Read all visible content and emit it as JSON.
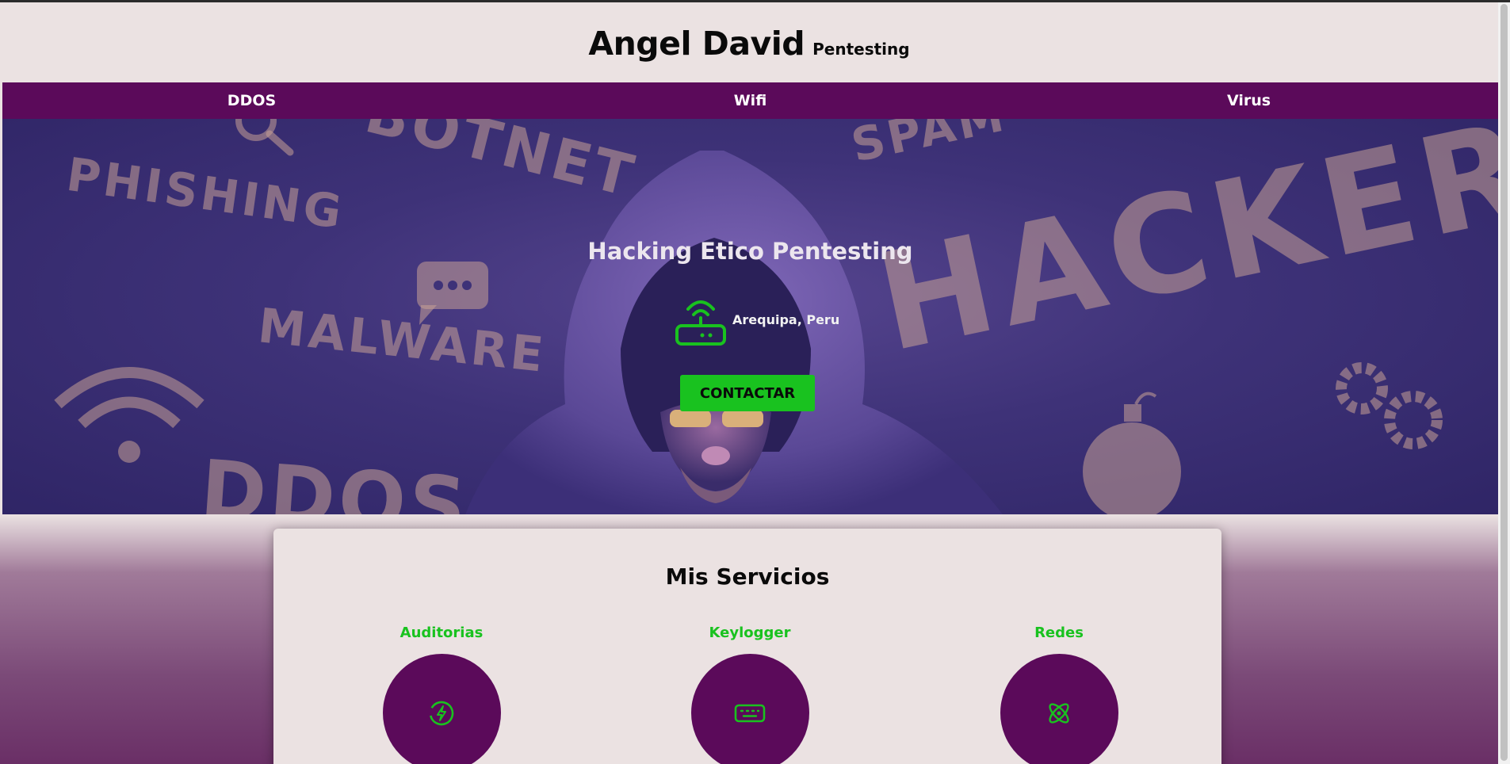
{
  "header": {
    "brand_name": "Angel David",
    "brand_tag": "Pentesting"
  },
  "nav": {
    "items": [
      {
        "label": "DDOS"
      },
      {
        "label": "Wifi"
      },
      {
        "label": "Virus"
      }
    ]
  },
  "hero": {
    "title": "Hacking Etico Pentesting",
    "location": "Arequipa, Peru",
    "contact_label": "CONTACTAR",
    "background_words": [
      "PHISHING",
      "BOTNET",
      "SPAM",
      "HACKER",
      "MALWARE",
      "DDOS"
    ]
  },
  "services": {
    "title": "Mis Servicios",
    "items": [
      {
        "label": "Auditorias",
        "icon": "power-charge-icon"
      },
      {
        "label": "Keylogger",
        "icon": "keyboard-icon"
      },
      {
        "label": "Redes",
        "icon": "atom-icon"
      }
    ]
  },
  "colors": {
    "nav_bg": "#5b0a5a",
    "accent_green": "#19c21f",
    "page_bg": "#ebe2e2",
    "hero_purple": "#3e3278"
  }
}
